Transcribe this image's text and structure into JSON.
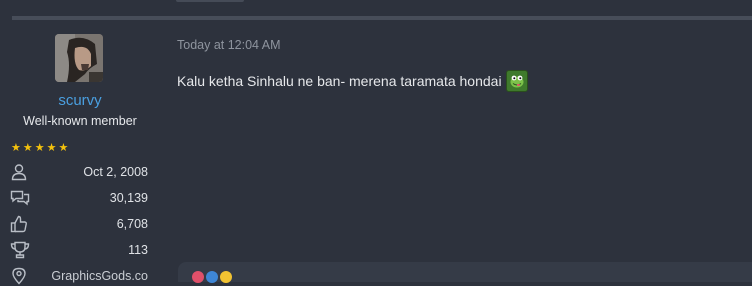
{
  "post": {
    "author": {
      "username": "scurvy",
      "title": "Well-known member",
      "stars": [
        "★",
        "★",
        "★",
        "★",
        "★"
      ],
      "stats": [
        {
          "icon": "user-icon",
          "value": "Oct 2, 2008"
        },
        {
          "icon": "messages-icon",
          "value": "30,139"
        },
        {
          "icon": "thumbs-up-icon",
          "value": "6,708"
        },
        {
          "icon": "trophy-icon",
          "value": "113"
        },
        {
          "icon": "location-icon",
          "value": "GraphicsGods.co"
        }
      ]
    },
    "date": "Today at 12:04 AM",
    "message": "Kalu ketha Sinhalu ne ban- merena taramata hondai"
  },
  "colors": {
    "background": "#2d323d",
    "username": "#4a9fe0",
    "stars": "#f4c20d"
  }
}
